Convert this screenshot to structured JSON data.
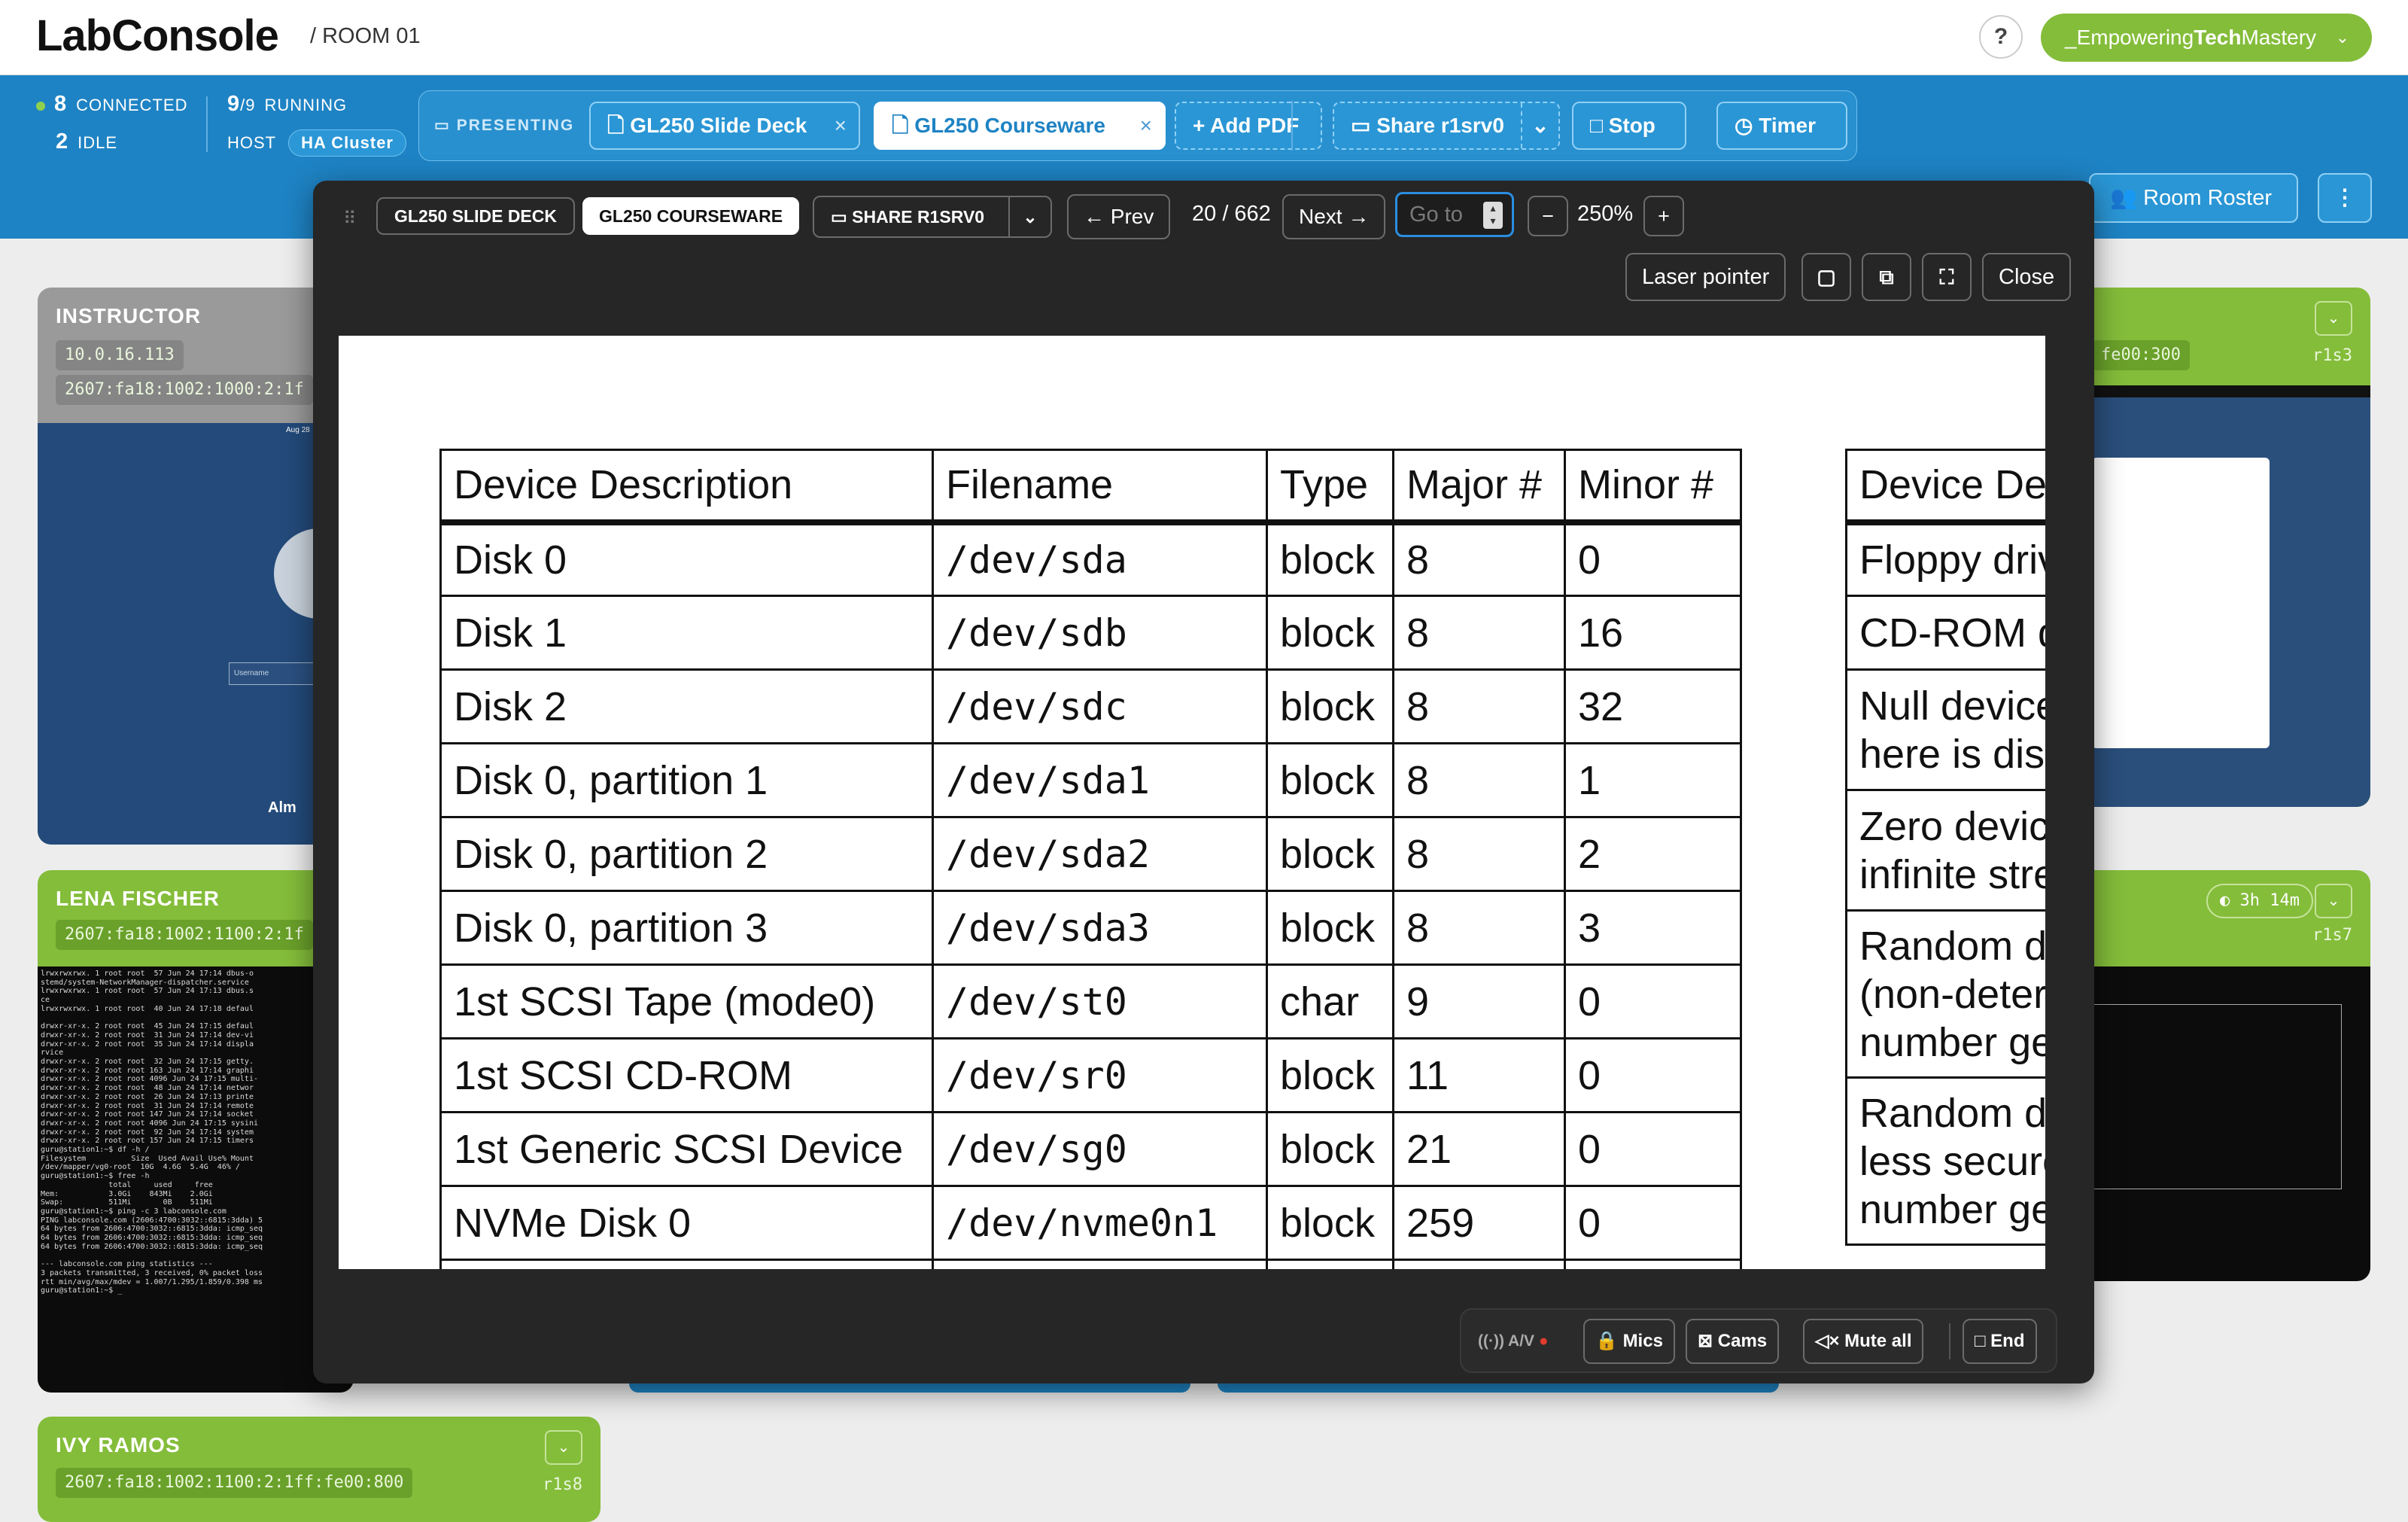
{
  "app": {
    "name": "LabConsole",
    "room": "/ ROOM 01",
    "help": "?",
    "user_prefix": "_Empowering",
    "user_bold": "Tech",
    "user_suffix": "Mastery"
  },
  "stats": {
    "connected_n": "8",
    "connected_label": "CONNECTED",
    "idle_n": "2",
    "idle_label": "IDLE",
    "running_n": "9",
    "running_total": "/9",
    "running_label": "RUNNING",
    "host_label": "HOST",
    "host_value": "HA Cluster"
  },
  "presenting": {
    "label": "PRESENTING",
    "tabs": [
      {
        "label": "GL250 Slide Deck"
      },
      {
        "label": "GL250 Courseware"
      }
    ],
    "add_pdf": "Add PDF",
    "share": "Share r1srv0",
    "stop": "Stop",
    "timer": "Timer"
  },
  "room_roster": "Room Roster",
  "cards": {
    "instructor": {
      "name": "INSTRUCTOR",
      "ip1": "10.0.16.113",
      "ip2": "2607:fa18:1002:1000:2:1f",
      "login_placeholder": "Username",
      "brand": "Alm",
      "time": "Aug 28"
    },
    "lena": {
      "name": "LENA FISCHER",
      "ip": "2607:fa18:1002:1100:2:1f"
    },
    "ivy": {
      "name": "IVY RAMOS",
      "ip": "2607:fa18:1002:1100:2:1ff:fe00:800",
      "station": "r1s8"
    },
    "right1": {
      "ip": "fe00:300",
      "station": "r1s3"
    },
    "right2": {
      "timer": "3h 14m",
      "station": "r1s7"
    }
  },
  "viewer": {
    "tabs": [
      "GL250 SLIDE DECK",
      "GL250 COURSEWARE"
    ],
    "share": "SHARE R1SRV0",
    "prev": "← Prev",
    "page": "20 / 662",
    "next": "Next →",
    "goto_placeholder": "Go to",
    "zoom": "250%",
    "minus": "−",
    "plus": "+",
    "laser": "Laser pointer",
    "close": "Close"
  },
  "slide_table": {
    "headers": [
      "Device Description",
      "Filename",
      "Type",
      "Major #",
      "Minor #"
    ],
    "rows": [
      [
        "Disk 0",
        "/dev/sda",
        "block",
        "8",
        "0"
      ],
      [
        "Disk 1",
        "/dev/sdb",
        "block",
        "8",
        "16"
      ],
      [
        "Disk 2",
        "/dev/sdc",
        "block",
        "8",
        "32"
      ],
      [
        "Disk 0, partition 1",
        "/dev/sda1",
        "block",
        "8",
        "1"
      ],
      [
        "Disk 0, partition 2",
        "/dev/sda2",
        "block",
        "8",
        "2"
      ],
      [
        "Disk 0, partition 3",
        "/dev/sda3",
        "block",
        "8",
        "3"
      ],
      [
        "1st SCSI Tape (mode0)",
        "/dev/st0",
        "char",
        "9",
        "0"
      ],
      [
        "1st SCSI CD-ROM",
        "/dev/sr0",
        "block",
        "11",
        "0"
      ],
      [
        "1st Generic SCSI Device",
        "/dev/sg0",
        "block",
        "21",
        "0"
      ],
      [
        "NVMe Disk 0",
        "/dev/nvme0n1",
        "block",
        "259",
        "0"
      ]
    ]
  },
  "slide_table2": {
    "header": "Device Des",
    "rows": [
      "Floppy driv",
      "CD-ROM d",
      "Null device|here is disc",
      "Zero device|infinite stre",
      "Random de|(non-determ|number ge",
      "Random de|less secure|number ge"
    ]
  },
  "av": {
    "label": "A/V",
    "mics": "Mics",
    "cams": "Cams",
    "mute_all": "Mute all",
    "end": "End"
  }
}
